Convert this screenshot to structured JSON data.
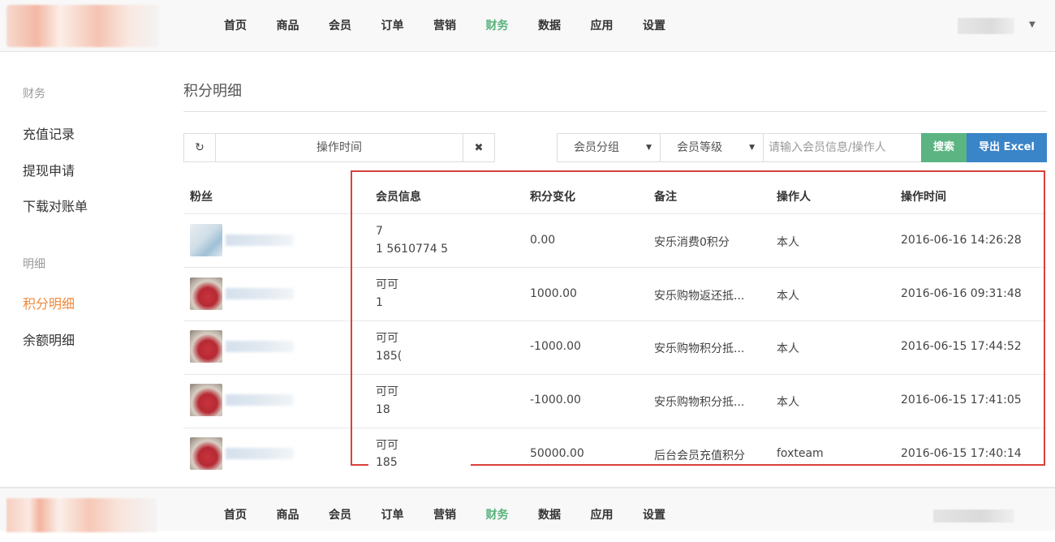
{
  "nav": {
    "items": [
      "首页",
      "商品",
      "会员",
      "订单",
      "营销",
      "财务",
      "数据",
      "应用",
      "设置"
    ],
    "active_index": 5
  },
  "sidebar": {
    "section1": "财务",
    "items1": [
      "充值记录",
      "提现申请",
      "下载对账单"
    ],
    "section2": "明细",
    "items2": [
      "积分明细",
      "余额明细"
    ],
    "active": "积分明细"
  },
  "main": {
    "title": "积分明细",
    "toolbar": {
      "refresh_icon": "refresh-icon",
      "time_filter": "操作时间",
      "clear_icon": "close-icon",
      "group_select": "会员分组",
      "level_select": "会员等级",
      "search_placeholder": "请输入会员信息/操作人",
      "search_button": "搜索",
      "export_button": "导出 Excel"
    },
    "table": {
      "headers": [
        "粉丝",
        "会员信息",
        "积分变化",
        "备注",
        "操作人",
        "操作时间"
      ],
      "rows": [
        {
          "member_line1": "7",
          "member_line2": "1 5610774 5",
          "points": "0.00",
          "note": "安乐消费0积分",
          "operator": "本人",
          "time": "2016-06-16 14:26:28"
        },
        {
          "member_line1": "可可",
          "member_line2": "1",
          "points": "1000.00",
          "note": "安乐购物返还抵...",
          "operator": "本人",
          "time": "2016-06-16 09:31:48"
        },
        {
          "member_line1": "可可",
          "member_line2": "185(",
          "points": "-1000.00",
          "note": "安乐购物积分抵...",
          "operator": "本人",
          "time": "2016-06-15 17:44:52"
        },
        {
          "member_line1": "可可",
          "member_line2": "18",
          "points": "-1000.00",
          "note": "安乐购物积分抵...",
          "operator": "本人",
          "time": "2016-06-15 17:41:05"
        },
        {
          "member_line1": "可可",
          "member_line2": "185",
          "points": "50000.00",
          "note": "后台会员充值积分",
          "operator": "foxteam",
          "time": "2016-06-15 17:40:14"
        }
      ]
    }
  },
  "colors": {
    "active_nav": "#58b27b",
    "active_sidebar": "#f0883a",
    "search_button": "#5bb482",
    "export_button": "#3a84c8",
    "highlight_box": "#d9403a"
  }
}
